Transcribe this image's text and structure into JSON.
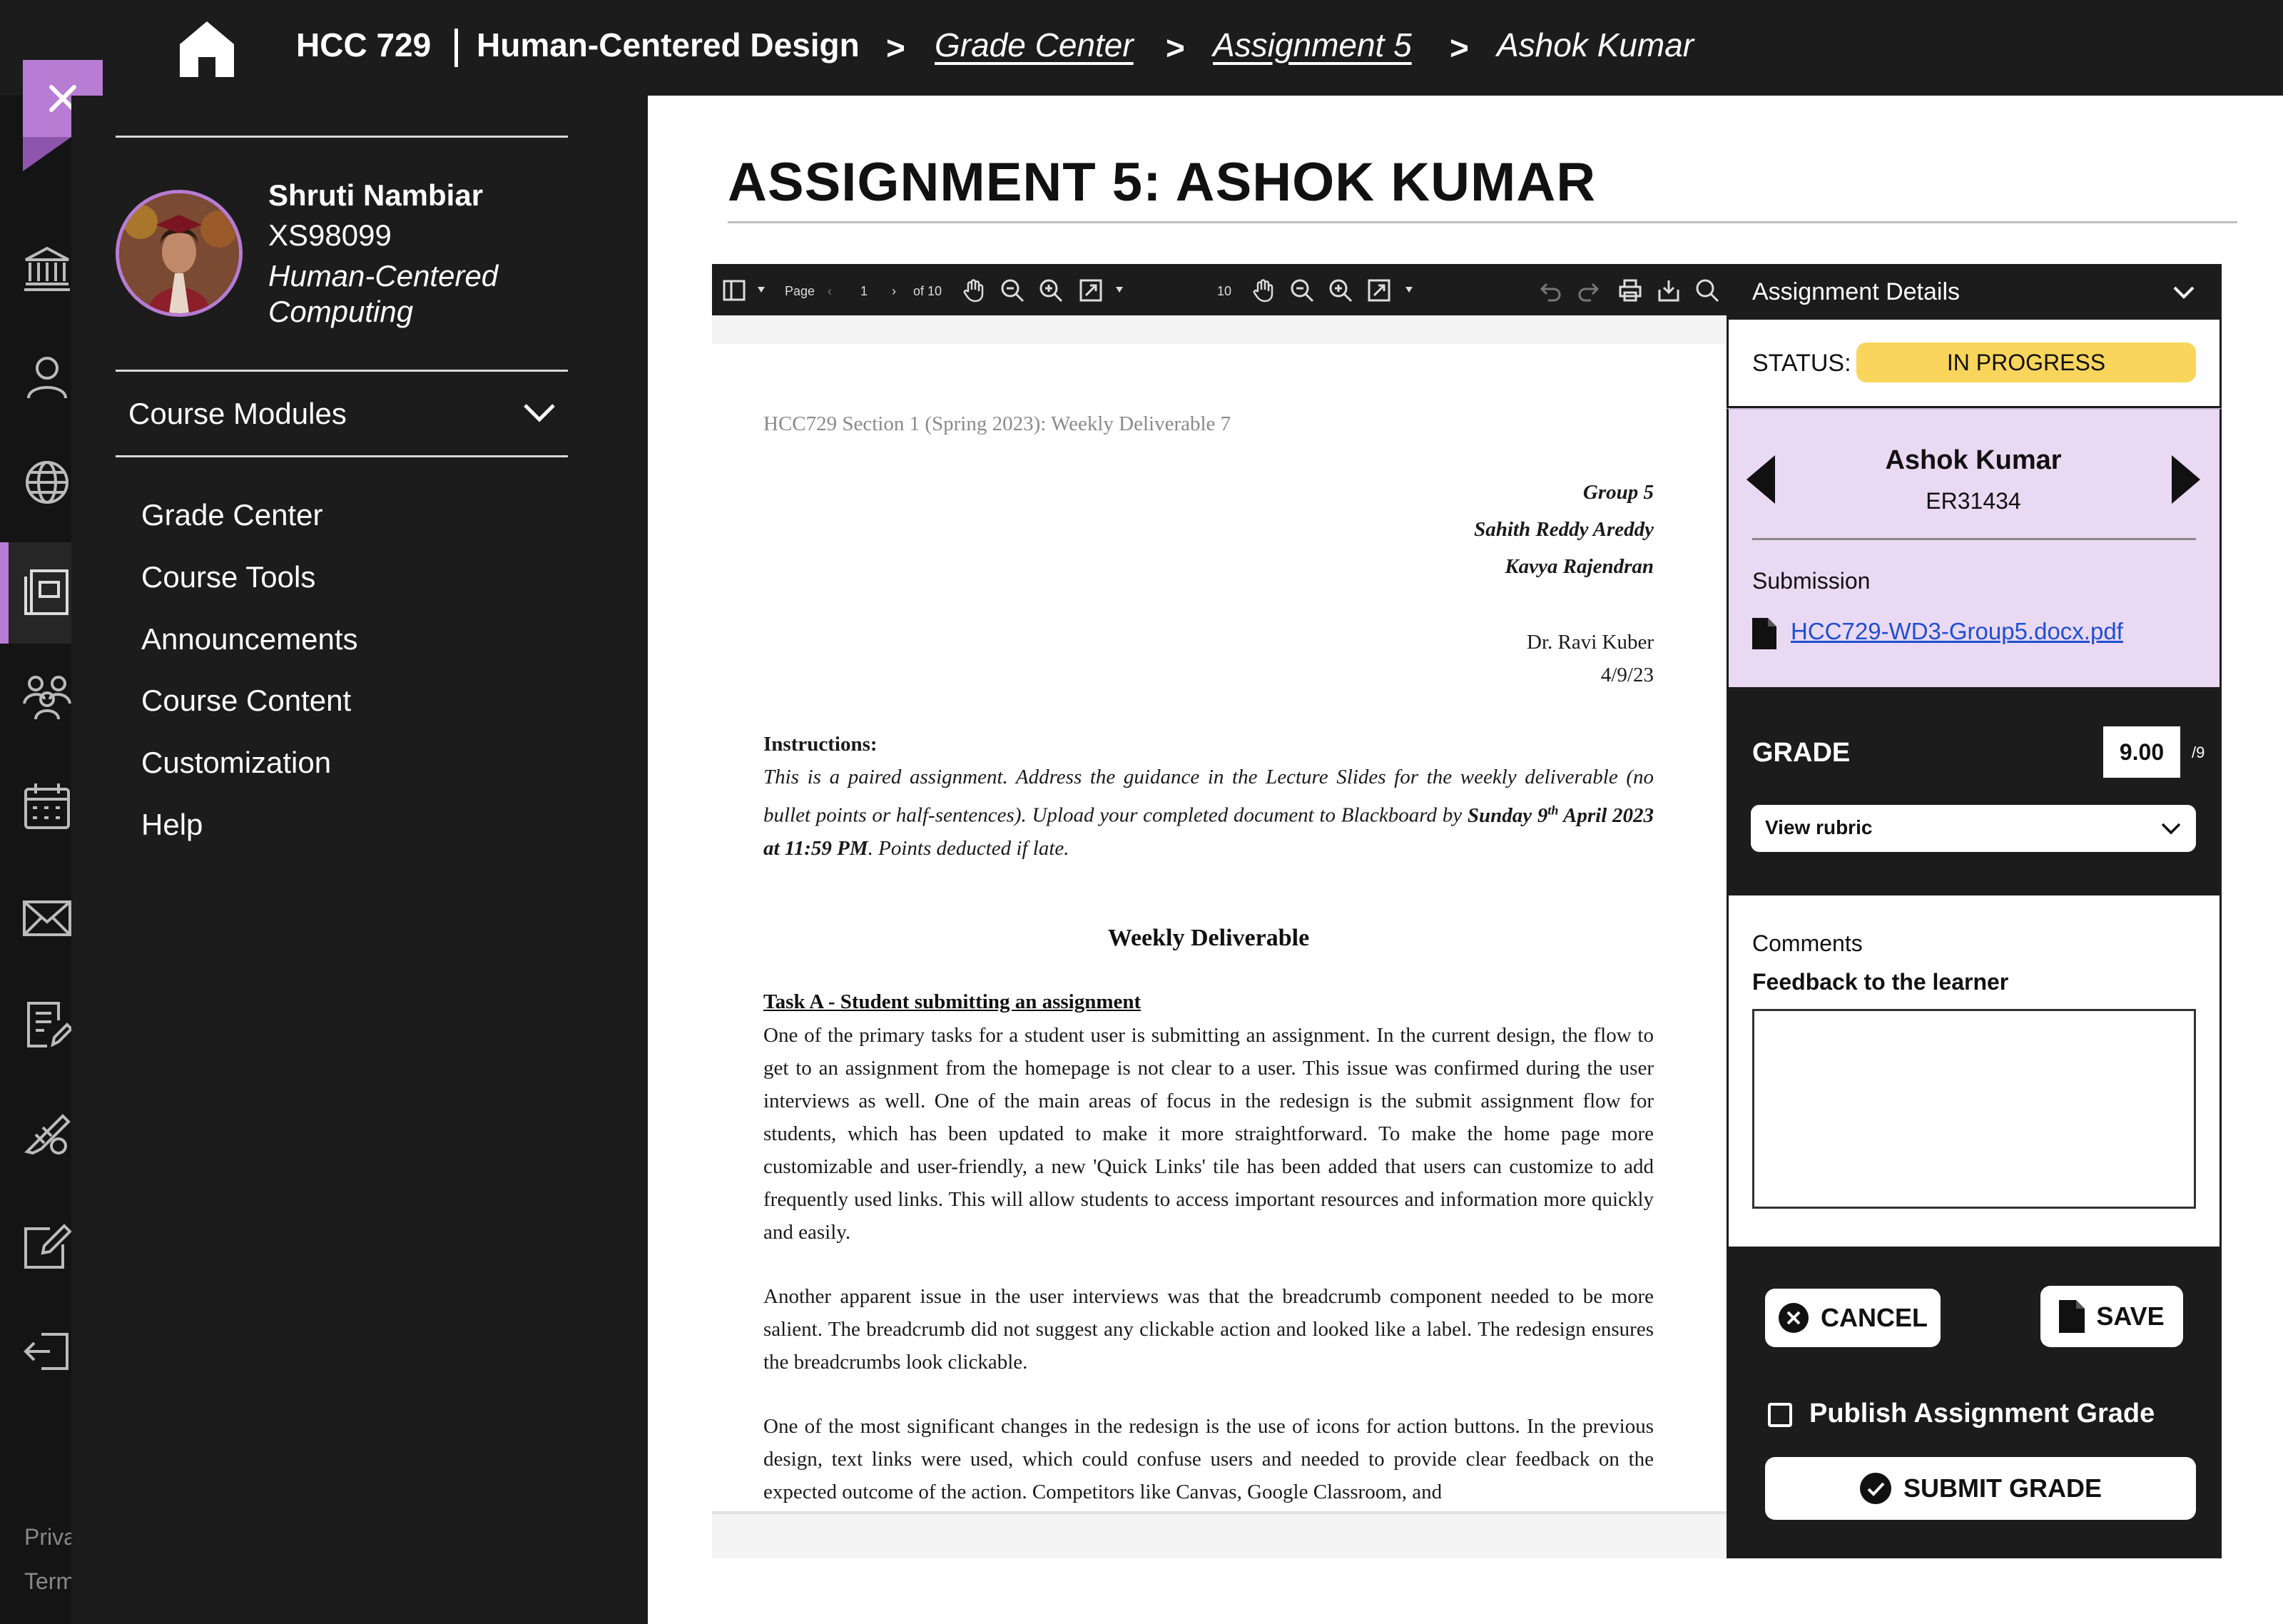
{
  "breadcrumb": {
    "course_code": "HCC 729",
    "course_name": "Human-Centered Design",
    "separator": ">",
    "grade_center": "Grade Center",
    "assignment": "Assignment 5",
    "student": "Ashok Kumar"
  },
  "rail": {
    "footer_privacy": "Priva",
    "footer_terms": "Term"
  },
  "user": {
    "name": "Shruti Nambiar",
    "id": "XS98099",
    "program": "Human-Centered Computing"
  },
  "sidebar": {
    "modules_label": "Course Modules",
    "items": [
      {
        "label": "Grade Center"
      },
      {
        "label": "Course Tools"
      },
      {
        "label": "Announcements"
      },
      {
        "label": "Course Content"
      },
      {
        "label": "Customization"
      },
      {
        "label": "Help"
      }
    ]
  },
  "page": {
    "title": "ASSIGNMENT 5: ASHOK KUMAR"
  },
  "pdf_toolbar": {
    "page_label": "Page",
    "page_number": "1",
    "page_total": "of 10",
    "zoom_value": "10"
  },
  "document": {
    "header": "HCC729 Section 1 (Spring 2023): Weekly Deliverable 7",
    "group": "Group 5",
    "member1": "Sahith Reddy Areddy",
    "member2": "Kavya Rajendran",
    "instructor": "Dr. Ravi Kuber",
    "date": "4/9/23",
    "instructions_label": "Instructions:",
    "instructions_pre": "This is a paired assignment. Address the guidance in the Lecture Slides for the weekly deliverable (no bullet points or half-sentences).  Upload your completed document to Blackboard by ",
    "instructions_due_a": "Sunday 9",
    "instructions_due_sup": "th",
    "instructions_due_b": " April 2023 at 11:59 PM",
    "instructions_post": ".  Points deducted if late.",
    "heading": "Weekly Deliverable",
    "task_a": "Task A - Student submitting an assignment",
    "para1": "One of the primary tasks for a student user is submitting an assignment. In the current design, the flow to get to an assignment from the homepage is not clear to a user. This issue was confirmed during the user interviews as well. One of the main areas of focus in the redesign is the submit assignment flow for students, which has been updated to make it more straightforward. To make the home page more customizable and user-friendly, a new 'Quick Links' tile has been added that users can customize to add frequently used links. This will allow students to access important resources and information more quickly and easily.",
    "para2": "Another apparent issue in the user interviews was that the breadcrumb component needed to be more salient. The breadcrumb did not suggest any clickable action and looked like a label. The redesign ensures the breadcrumbs look clickable.",
    "para3": "One of the most significant changes in the redesign is the use of icons for action buttons. In the previous design, text links were used, which could confuse users and needed to provide clear feedback on the expected outcome of the action. Competitors like Canvas, Google Classroom, and"
  },
  "details": {
    "title": "Assignment Details",
    "status_label": "STATUS:",
    "status_value": "IN PROGRESS",
    "status_color": "#f9d55b",
    "student_name": "Ashok Kumar",
    "student_id": "ER31434",
    "submission_label": "Submission",
    "file_name": "HCC729-WD3-Group5.docx.pdf",
    "grade_label": "GRADE",
    "grade_value": "9.00",
    "grade_max": "/9",
    "rubric_label": "View rubric",
    "comments_label": "Comments",
    "feedback_label": "Feedback to the learner",
    "feedback_value": ""
  },
  "actions": {
    "cancel_label": "CANCEL",
    "save_label": "SAVE",
    "publish_label": "Publish Assignment Grade",
    "publish_checked": false,
    "submit_label": "SUBMIT GRADE"
  },
  "colors": {
    "accent": "#b77cd3",
    "student_panel": "#ead9f3",
    "link": "#1f4fd1"
  }
}
